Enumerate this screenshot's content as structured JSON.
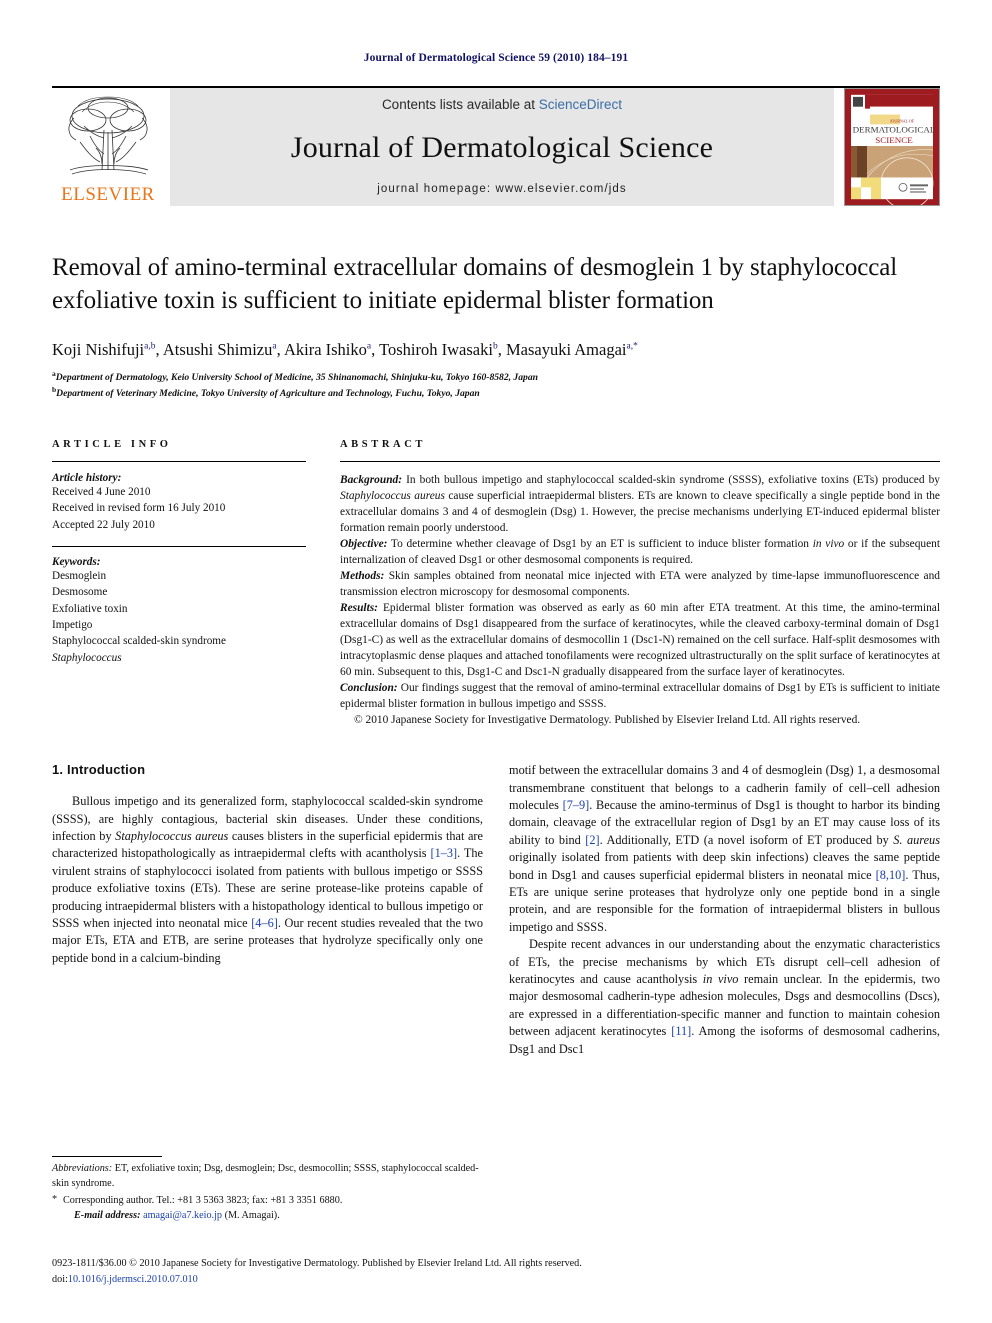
{
  "running_head": "Journal of Dermatological Science 59 (2010) 184–191",
  "masthead": {
    "contents_prefix": "Contents lists available at ",
    "sciencedirect": "ScienceDirect",
    "journal_title": "Journal of Dermatological Science",
    "homepage": "journal homepage: www.elsevier.com/jds",
    "publisher_wordmark": "ELSEVIER",
    "cover_title_small": "JOURNAL OF",
    "cover_title_line1": "DERMATOLOGICAL",
    "cover_title_line2": "SCIENCE",
    "accent_orange": "#E8761B",
    "link_blue": "#3a6ea5",
    "band_gray": "#e6e6e6"
  },
  "title": "Removal of amino-terminal extracellular domains of desmoglein 1 by staphylococcal exfoliative toxin is sufficient to initiate epidermal blister formation",
  "authors_html": "Koji Nishifuji<sup>a,b</sup>, Atsushi Shimizu<sup>a</sup>, Akira Ishiko<sup>a</sup>, Toshiroh Iwasaki<sup>b</sup>, Masayuki Amagai<sup>a,*</sup>",
  "affiliations": [
    "Department of Dermatology, Keio University School of Medicine, 35 Shinanomachi, Shinjuku-ku, Tokyo 160-8582, Japan",
    "Department of Veterinary Medicine, Tokyo University of Agriculture and Technology, Fuchu, Tokyo, Japan"
  ],
  "affiliation_marks": [
    "a",
    "b"
  ],
  "article_info": {
    "heading": "ARTICLE INFO",
    "history_label": "Article history:",
    "history": [
      "Received 4 June 2010",
      "Received in revised form 16 July 2010",
      "Accepted 22 July 2010"
    ],
    "keywords_label": "Keywords:",
    "keywords": [
      "Desmoglein",
      "Desmosome",
      "Exfoliative toxin",
      "Impetigo",
      "Staphylococcal scalded-skin syndrome",
      "Staphylococcus"
    ],
    "keywords_italic_index": 5
  },
  "abstract": {
    "heading": "ABSTRACT",
    "background_label": "Background:",
    "background_text": " In both bullous impetigo and staphylococcal scalded-skin syndrome (SSSS), exfoliative toxins (ETs) produced by Staphylococcus aureus cause superficial intraepidermal blisters. ETs are known to cleave specifically a single peptide bond in the extracellular domains 3 and 4 of desmoglein (Dsg) 1. However, the precise mechanisms underlying ET-induced epidermal blister formation remain poorly understood.",
    "objective_label": "Objective:",
    "objective_text": " To determine whether cleavage of Dsg1 by an ET is sufficient to induce blister formation in vivo or if the subsequent internalization of cleaved Dsg1 or other desmosomal components is required.",
    "methods_label": "Methods:",
    "methods_text": " Skin samples obtained from neonatal mice injected with ETA were analyzed by time-lapse immunofluorescence and transmission electron microscopy for desmosomal components.",
    "results_label": "Results:",
    "results_text": " Epidermal blister formation was observed as early as 60 min after ETA treatment. At this time, the amino-terminal extracellular domains of Dsg1 disappeared from the surface of keratinocytes, while the cleaved carboxy-terminal domain of Dsg1 (Dsg1-C) as well as the extracellular domains of desmocollin 1 (Dsc1-N) remained on the cell surface. Half-split desmosomes with intracytoplasmic dense plaques and attached tonofilaments were recognized ultrastructurally on the split surface of keratinocytes at 60 min. Subsequent to this, Dsg1-C and Dsc1-N gradually disappeared from the surface layer of keratinocytes.",
    "conclusion_label": "Conclusion:",
    "conclusion_text": " Our findings suggest that the removal of amino-terminal extracellular domains of Dsg1 by ETs is sufficient to initiate epidermal blister formation in bullous impetigo and SSSS.",
    "copyright": "© 2010 Japanese Society for Investigative Dermatology. Published by Elsevier Ireland Ltd. All rights reserved."
  },
  "body": {
    "section_number_title": "1. Introduction",
    "left_paragraph_1": "Bullous impetigo and its generalized form, staphylococcal scalded-skin syndrome (SSSS), are highly contagious, bacterial skin diseases. Under these conditions, infection by Staphylococcus aureus causes blisters in the superficial epidermis that are characterized histopathologically as intraepidermal clefts with acantholysis [1–3]. The virulent strains of staphylococci isolated from patients with bullous impetigo or SSSS produce exfoliative toxins (ETs). These are serine protease-like proteins capable of producing intraepidermal blisters with a histopathology identical to bullous impetigo or SSSS when injected into neonatal mice [4–6]. Our recent studies revealed that the two major ETs, ETA and ETB, are serine proteases that hydrolyze specifically only one peptide bond in a calcium-binding",
    "right_paragraph_1": "motif between the extracellular domains 3 and 4 of desmoglein (Dsg) 1, a desmosomal transmembrane constituent that belongs to a cadherin family of cell–cell adhesion molecules [7–9]. Because the amino-terminus of Dsg1 is thought to harbor its binding domain, cleavage of the extracellular region of Dsg1 by an ET may cause loss of its ability to bind [2]. Additionally, ETD (a novel isoform of ET produced by S. aureus originally isolated from patients with deep skin infections) cleaves the same peptide bond in Dsg1 and causes superficial epidermal blisters in neonatal mice [8,10]. Thus, ETs are unique serine proteases that hydrolyze only one peptide bond in a single protein, and are responsible for the formation of intraepidermal blisters in bullous impetigo and SSSS.",
    "right_paragraph_2": "Despite recent advances in our understanding about the enzymatic characteristics of ETs, the precise mechanisms by which ETs disrupt cell–cell adhesion of keratinocytes and cause acantholysis in vivo remain unclear. In the epidermis, two major desmosomal cadherin-type adhesion molecules, Dsgs and desmocollins (Dscs), are expressed in a differentiation-specific manner and function to maintain cohesion between adjacent keratinocytes [11]. Among the isoforms of desmosomal cadherins, Dsg1 and Dsc1"
  },
  "footnotes": {
    "abbreviations_label": "Abbreviations:",
    "abbreviations_text": " ET, exfoliative toxin; Dsg, desmoglein; Dsc, desmocollin; SSSS, staphylococcal scalded-skin syndrome.",
    "corresponding_star": "*",
    "corresponding_text": "Corresponding author. Tel.: +81 3 5363 3823; fax: +81 3 3351 6880.",
    "email_label": "E-mail address:",
    "email_address": "amagai@a7.keio.jp",
    "email_suffix": " (M. Amagai)."
  },
  "bottom": {
    "issn_line": "0923-1811/$36.00 © 2010 Japanese Society for Investigative Dermatology. Published by Elsevier Ireland Ltd. All rights reserved.",
    "doi_prefix": "doi:",
    "doi_value": "10.1016/j.jdermsci.2010.07.010"
  }
}
